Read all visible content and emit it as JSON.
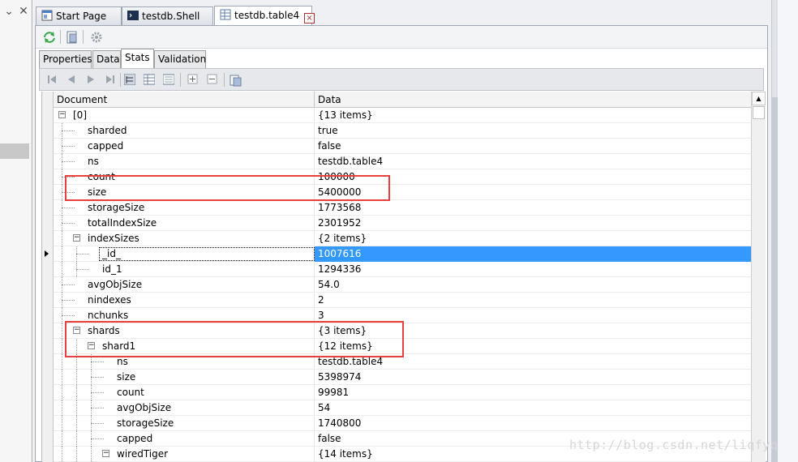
{
  "tabs": [
    {
      "label": "Start Page",
      "icon": "start-page-icon",
      "active": false
    },
    {
      "label": "testdb.Shell",
      "icon": "shell-icon",
      "active": false
    },
    {
      "label": "testdb.table4",
      "icon": "table-icon",
      "active": true
    }
  ],
  "subtabs": [
    "Properties",
    "Data",
    "Stats",
    "Validation"
  ],
  "active_subtab": "Stats",
  "columns": {
    "document": "Document",
    "data": "Data"
  },
  "rows": [
    {
      "key": "[0]",
      "value": "{13 items}",
      "depth": 0,
      "expander": "collapse"
    },
    {
      "key": "sharded",
      "value": "true",
      "depth": 1
    },
    {
      "key": "capped",
      "value": "false",
      "depth": 1
    },
    {
      "key": "ns",
      "value": "testdb.table4",
      "depth": 1
    },
    {
      "key": "count",
      "value": "100000",
      "depth": 1
    },
    {
      "key": "size",
      "value": "5400000",
      "depth": 1
    },
    {
      "key": "storageSize",
      "value": "1773568",
      "depth": 1
    },
    {
      "key": "totalIndexSize",
      "value": "2301952",
      "depth": 1
    },
    {
      "key": "indexSizes",
      "value": "{2 items}",
      "depth": 1,
      "expander": "collapse"
    },
    {
      "key": "_id_",
      "value": "1007616",
      "depth": 2,
      "selected": true
    },
    {
      "key": "id_1",
      "value": "1294336",
      "depth": 2
    },
    {
      "key": "avgObjSize",
      "value": "54.0",
      "depth": 1
    },
    {
      "key": "nindexes",
      "value": "2",
      "depth": 1
    },
    {
      "key": "nchunks",
      "value": "3",
      "depth": 1
    },
    {
      "key": "shards",
      "value": "{3 items}",
      "depth": 1,
      "expander": "collapse"
    },
    {
      "key": "shard1",
      "value": "{12 items}",
      "depth": 2,
      "expander": "collapse"
    },
    {
      "key": "ns",
      "value": "testdb.table4",
      "depth": 3
    },
    {
      "key": "size",
      "value": "5398974",
      "depth": 3
    },
    {
      "key": "count",
      "value": "99981",
      "depth": 3
    },
    {
      "key": "avgObjSize",
      "value": "54",
      "depth": 3
    },
    {
      "key": "storageSize",
      "value": "1740800",
      "depth": 3
    },
    {
      "key": "capped",
      "value": "false",
      "depth": 3
    },
    {
      "key": "wiredTiger",
      "value": "{14 items}",
      "depth": 3,
      "expander": "collapse"
    }
  ],
  "watermark": "http://blog.csdn.net/liqfyq",
  "colors": {
    "highlight_box": "#e8403c",
    "selection": "#3399ff"
  }
}
